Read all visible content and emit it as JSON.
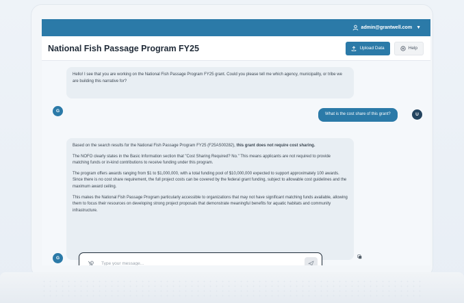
{
  "topbar": {
    "user_email": "admin@grantwell.com",
    "user_icon": "user-icon",
    "chevron": "▼"
  },
  "header": {
    "title": "National Fish Passage Program FY25",
    "upload_label": "Upload Data",
    "help_label": "Help"
  },
  "messages": {
    "bot1": {
      "avatar": "G",
      "text": "Hello! I see that you are working on the National Fish Passage Program FY25 grant. Could you please tell me which agency, municipality, or tribe we are building this narrative for?"
    },
    "user1": {
      "avatar": "U",
      "text": "What is the cost share of this grant?"
    },
    "bot2": {
      "avatar": "G",
      "p1_start": "Based on the search results for the National Fish Passage Program FY25 (F25AS00282), ",
      "p1_bold": "this grant does not require cost sharing.",
      "p2": "The NOFO clearly states in the Basic Information section that \"Cost Sharing Required? No.\" This means applicants are not required to provide matching funds or in-kind contributions to receive funding under this program.",
      "p3": "The program offers awards ranging from $1 to $1,000,000, with a total funding pool of $10,000,000 expected to support approximately 100 awards. Since there is no cost share requirement, the full project costs can be covered by the federal grant funding, subject to allowable cost guidelines and the maximum award ceiling.",
      "p4": "This makes the National Fish Passage Program particularly accessible to organizations that may not have significant matching funds available, allowing them to focus their resources on developing strong project proposals that demonstrate meaningful benefits for aquatic habitats and community infrastructure."
    }
  },
  "composer": {
    "placeholder": "Type your message...",
    "value": ""
  },
  "colors": {
    "brand": "#2b7aa8",
    "user_avatar": "#23445f",
    "bot_bubble": "#e8eef3"
  }
}
